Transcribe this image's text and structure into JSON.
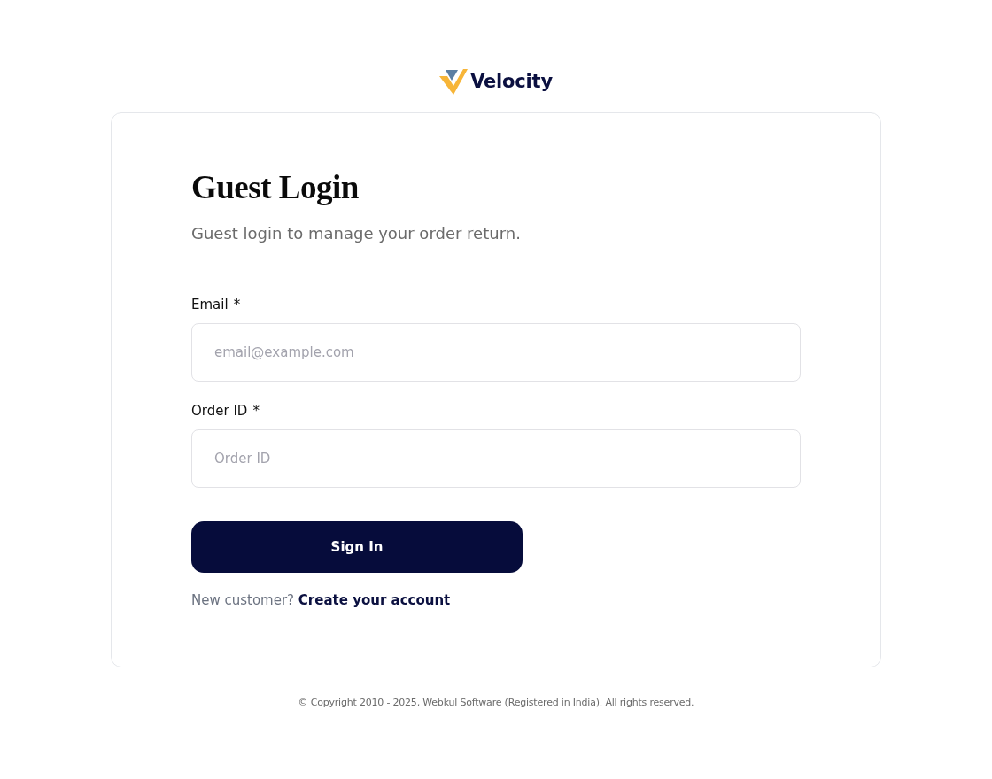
{
  "brand": {
    "name": "Velocity"
  },
  "form": {
    "title": "Guest Login",
    "subtitle": "Guest login to manage your order return.",
    "fields": [
      {
        "label": "Email",
        "required_mark": "*",
        "placeholder": "email@example.com"
      },
      {
        "label": "Order ID",
        "required_mark": "*",
        "placeholder": "Order ID"
      }
    ],
    "submit": "Sign In",
    "signup_prompt": {
      "text": "New customer?",
      "link": "Create your account"
    }
  },
  "footer": "© Copyright 2010 - 2025, Webkul Software (Registered in India). All rights reserved."
}
